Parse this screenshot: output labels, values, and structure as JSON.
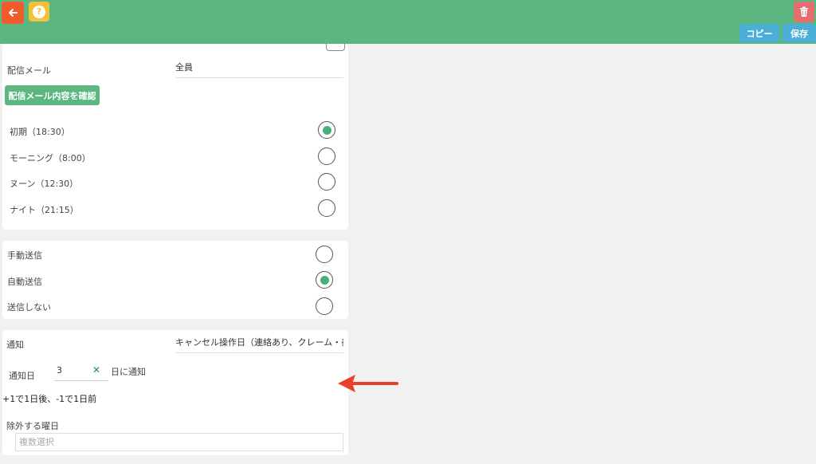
{
  "header": {
    "copy_label": "コピー",
    "save_label": "保存",
    "help_glyph": "?",
    "back_icon": "arrow-left-icon",
    "trash_icon": "trash-icon",
    "accent": "#5bb680"
  },
  "delivery": {
    "mail_label": "配信メール",
    "mail_value": "全員",
    "confirm_label": "配信メール内容を確認",
    "options": [
      {
        "label": "初期（18:30）",
        "selected": true
      },
      {
        "label": "モーニング（8:00）",
        "selected": false
      },
      {
        "label": "ヌーン（12:30）",
        "selected": false
      },
      {
        "label": "ナイト（21:15）",
        "selected": false
      }
    ]
  },
  "send_mode": {
    "options": [
      {
        "label": "手動送信",
        "selected": false
      },
      {
        "label": "自動送信",
        "selected": true
      },
      {
        "label": "送信しない",
        "selected": false
      }
    ]
  },
  "notify": {
    "label": "通知",
    "value": "キャンセル操作日（連絡あり、クレーム・義",
    "day_label": "通知日",
    "day_value": "3",
    "day_suffix": "日に通知",
    "hint": "+1で1日後、-1で1日前",
    "exclude_label": "除外する曜日",
    "exclude_placeholder": "複数選択"
  }
}
